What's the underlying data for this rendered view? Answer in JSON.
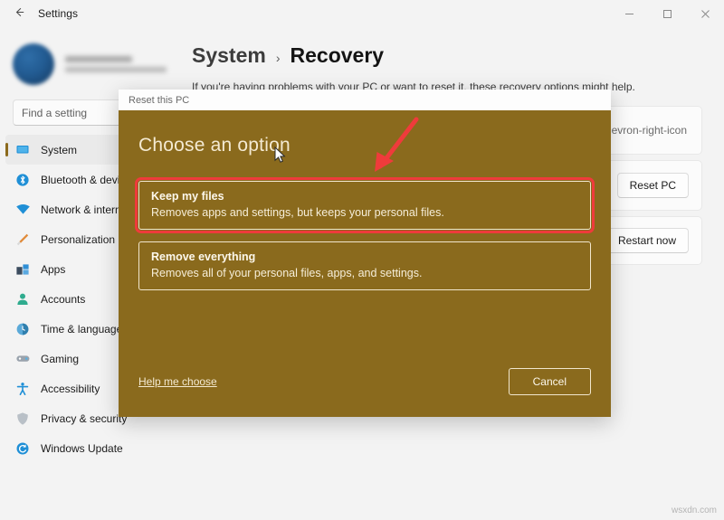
{
  "window": {
    "title": "Settings",
    "back_icon": "back-arrow-icon",
    "controls": {
      "minimize": "minimize-icon",
      "maximize": "maximize-icon",
      "close": "close-icon"
    }
  },
  "sidebar": {
    "account": {
      "name": "",
      "email": ""
    },
    "search": {
      "placeholder": "Find a setting",
      "value": "Find a setting",
      "icon": "search-icon"
    },
    "items": [
      {
        "label": "System",
        "icon": "monitor-icon",
        "selected": true
      },
      {
        "label": "Bluetooth & devices",
        "icon": "bluetooth-icon",
        "selected": false
      },
      {
        "label": "Network & internet",
        "icon": "wifi-icon",
        "selected": false
      },
      {
        "label": "Personalization",
        "icon": "paintbrush-icon",
        "selected": false
      },
      {
        "label": "Apps",
        "icon": "apps-icon",
        "selected": false
      },
      {
        "label": "Accounts",
        "icon": "person-icon",
        "selected": false
      },
      {
        "label": "Time & language",
        "icon": "clock-globe-icon",
        "selected": false
      },
      {
        "label": "Gaming",
        "icon": "gamepad-icon",
        "selected": false
      },
      {
        "label": "Accessibility",
        "icon": "accessibility-icon",
        "selected": false
      },
      {
        "label": "Privacy & security",
        "icon": "shield-icon",
        "selected": false
      },
      {
        "label": "Windows Update",
        "icon": "update-icon",
        "selected": false
      }
    ]
  },
  "content": {
    "breadcrumb": {
      "parent": "System",
      "separator": "›",
      "current": "Recovery"
    },
    "description": "If you're having problems with your PC or want to reset it, these recovery options might help.",
    "cards": [
      {
        "chevron": "chevron-right-icon"
      },
      {
        "button_label": "Reset PC"
      },
      {
        "button_label": "Restart now"
      }
    ]
  },
  "dialog": {
    "title": "Reset this PC",
    "heading": "Choose an option",
    "options": [
      {
        "title": "Keep my files",
        "description": "Removes apps and settings, but keeps your personal files.",
        "annotated": true
      },
      {
        "title": "Remove everything",
        "description": "Removes all of your personal files, apps, and settings.",
        "annotated": false
      }
    ],
    "help_link": "Help me choose",
    "cancel_label": "Cancel",
    "background_color": "#8a6a1d",
    "annotation_color": "#ef3b3b"
  },
  "annotations": {
    "arrow": "red-arrow-icon",
    "cursor": "mouse-cursor-icon"
  },
  "watermark": "wsxdn.com"
}
